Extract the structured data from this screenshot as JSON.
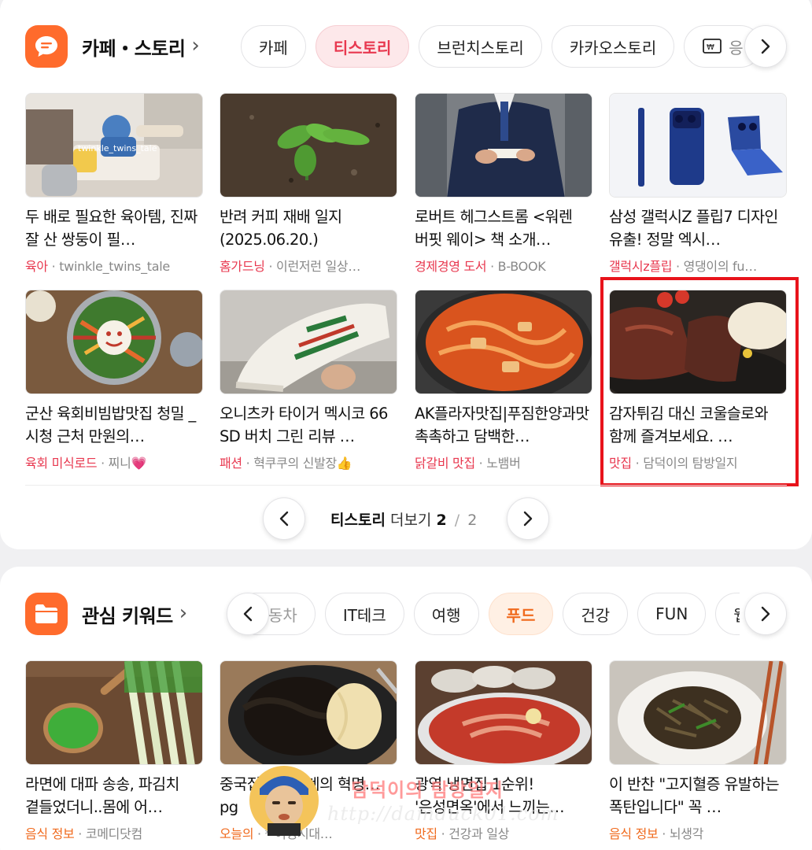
{
  "story_section": {
    "title": "카페・스토리",
    "tabs": [
      "카페",
      "티스토리",
      "브런치스토리",
      "카카오스토리",
      "응"
    ],
    "active_tab_index": 1,
    "cards": [
      {
        "title": "두 배로 필요한 육아템, 진짜 잘 산 쌍둥이 필…",
        "category": "육아",
        "source": "twinkle_twins_tale",
        "image": "nursery-play-area-photo"
      },
      {
        "title": "반려 커피 재배 일지(2025.06.20.)",
        "category": "홈가드닝",
        "source": "이런저런 일상…",
        "image": "coffee-seedling-photo"
      },
      {
        "title": "로버트 헤그스트롬 <워렌 버핏 웨이> 책 소개…",
        "category": "경제경영 도서",
        "source": "B-BOOK",
        "image": "man-in-suit-reading-photo"
      },
      {
        "title": "삼성 갤럭시Z 플립7 디자인 유출! 정말 엑시…",
        "category": "갤럭시z플립",
        "source": "영댕이의 fu…",
        "image": "blue-foldable-phone-photo"
      },
      {
        "title": "군산 육회비빔밥맛집 청밀 _ 시청 근처 만원의…",
        "category": "육회 미식로드",
        "source": "찌니💗",
        "image": "bibimbap-bowl-photo"
      },
      {
        "title": "오니츠카 타이거 멕시코 66 SD 버치 그린 리뷰 …",
        "category": "패션",
        "source": "혁쿠쿠의 신발장👍",
        "image": "white-sneaker-green-stripes-photo"
      },
      {
        "title": "AK플라자맛집|푸짐한양과맛 촉촉하고 담백한…",
        "category": "닭갈비 맛집",
        "source": "노뱀버",
        "image": "dakgalbi-pan-photo"
      },
      {
        "title": "감자튀김 대신 코울슬로와 함께 즐겨보세요. …",
        "category": "맛집",
        "source": "담덕이의 탐방일지",
        "image": "steak-plate-photo"
      }
    ],
    "pager": {
      "label": "티스토리",
      "more": "더보기",
      "current": "2",
      "sep": "/",
      "total": "2"
    }
  },
  "keyword_section": {
    "title": "관심 키워드",
    "tabs": [
      "동차",
      "IT테크",
      "여행",
      "푸드",
      "건강",
      "FUN",
      "웹툰"
    ],
    "active_tab_index": 3,
    "cards": [
      {
        "title": "라면에 대파 송송, 파김치 곁들었더니..몸에 어…",
        "category": "음식 정보",
        "source": "코메디닷컴",
        "image": "green-onion-spoon-photo"
      },
      {
        "title": "중국집 짜장면계의 혁명… pg",
        "category": "오늘의",
        "source": "* 여성시대…",
        "image": "jjajang-noodles-photo"
      },
      {
        "title": "광역 냉면집 1순위! '은성면옥'에서 느끼는…",
        "category": "맛집",
        "source": "건강과 일상",
        "image": "cold-noodles-photo"
      },
      {
        "title": "이 반찬 \"고지혈증 유발하는 폭탄입니다\" 꼭 …",
        "category": "음식 정보",
        "source": "뇌생각",
        "image": "anchovy-side-dish-photo"
      }
    ]
  },
  "watermark": {
    "text": "담덕이의 탐방일지",
    "url": "http://damduck01.com"
  },
  "colors": {
    "accent_red": "#e8384f",
    "accent_orange": "#f06a1d",
    "icon_orange": "#ff6b2c",
    "highlight_box": "#e8131b"
  }
}
